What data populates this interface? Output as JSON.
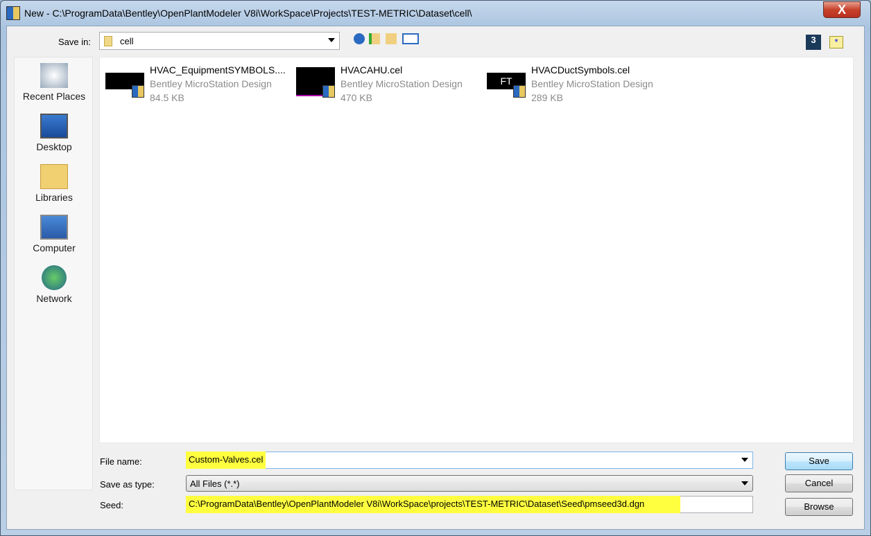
{
  "window": {
    "title": "New - C:\\ProgramData\\Bentley\\OpenPlantModeler V8i\\WorkSpace\\Projects\\TEST-METRIC\\Dataset\\cell\\",
    "close": "X"
  },
  "toolbar": {
    "save_in_label": "Save in:",
    "save_in_value": "cell"
  },
  "places": [
    {
      "label": "Recent Places"
    },
    {
      "label": "Desktop"
    },
    {
      "label": "Libraries"
    },
    {
      "label": "Computer"
    },
    {
      "label": "Network"
    }
  ],
  "files": [
    {
      "name": "HVAC_EquipmentSYMBOLS....",
      "type": "Bentley MicroStation Design",
      "size": "84.5 KB",
      "thumb": ""
    },
    {
      "name": "HVACAHU.cel",
      "type": "Bentley MicroStation Design",
      "size": "470 KB",
      "thumb": ""
    },
    {
      "name": "HVACDuctSymbols.cel",
      "type": "Bentley MicroStation Design",
      "size": "289 KB",
      "thumb": "FT"
    }
  ],
  "form": {
    "file_name_label": "File name:",
    "file_name_value": "Custom-Valves.cel",
    "type_label": "Save as type:",
    "type_value": "All Files (*.*)",
    "seed_label": "Seed:",
    "seed_value": "C:\\ProgramData\\Bentley\\OpenPlantModeler V8i\\WorkSpace\\projects\\TEST-METRIC\\Dataset\\Seed\\pmseed3d.dgn"
  },
  "buttons": {
    "save": "Save",
    "cancel": "Cancel",
    "browse": "Browse"
  }
}
